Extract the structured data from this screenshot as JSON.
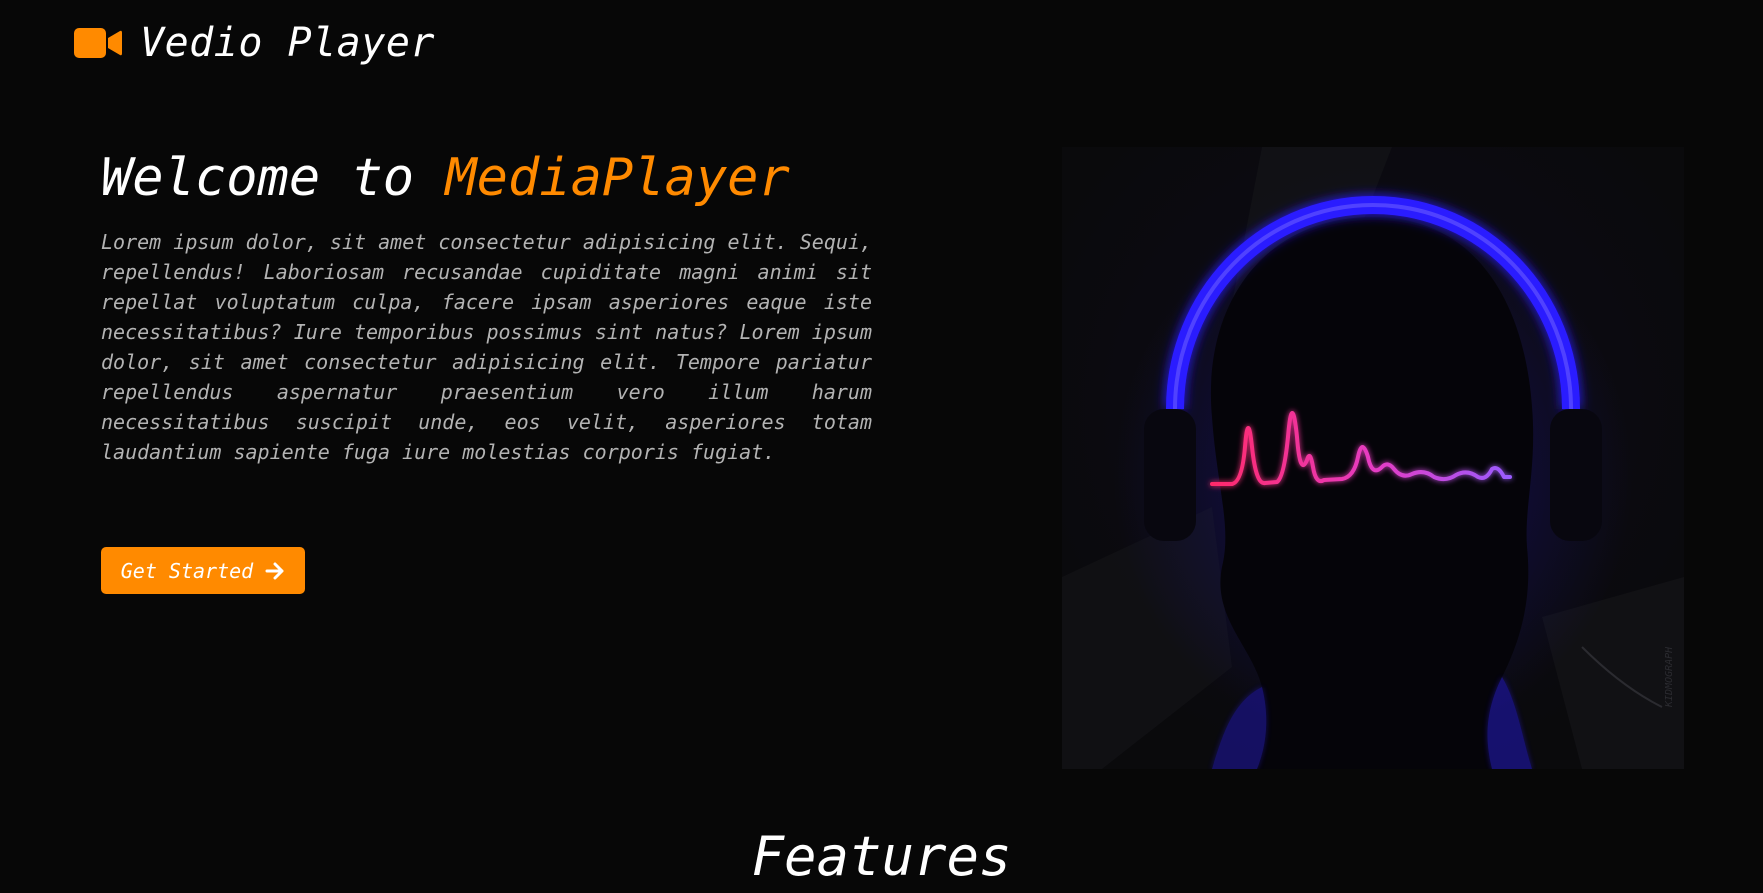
{
  "header": {
    "brand_icon": "video-camera-icon",
    "brand_name": "Vedio Player"
  },
  "hero": {
    "title_prefix": "Welcome to ",
    "title_highlight": "MediaPlayer",
    "description": "Lorem ipsum dolor, sit amet consectetur adipisicing elit. Sequi, repellendus! Laboriosam recusandae cupiditate magni animi sit repellat voluptatum culpa, facere ipsam asperiores eaque iste necessitatibus? Iure temporibus possimus sint natus? Lorem ipsum dolor, sit amet consectetur adipisicing elit. Tempore pariatur repellendus aspernatur praesentium vero illum harum necessitatibus suscipit unde, eos velit, asperiores totam laudantium sapiente fuga iure molestias corporis fugiat.",
    "cta_label": "Get Started",
    "cta_icon": "arrow-right-icon",
    "image": "neon-headphones-waveform-illustration",
    "image_watermark": "KIDMOGRAPH"
  },
  "features": {
    "title": "Features"
  },
  "colors": {
    "background": "#070707",
    "accent": "#ff8a00",
    "text": "#ffffff",
    "muted_text": "#b3b3b3",
    "neon_blue": "#2a1cff",
    "neon_pink": "#ff2a7a"
  }
}
